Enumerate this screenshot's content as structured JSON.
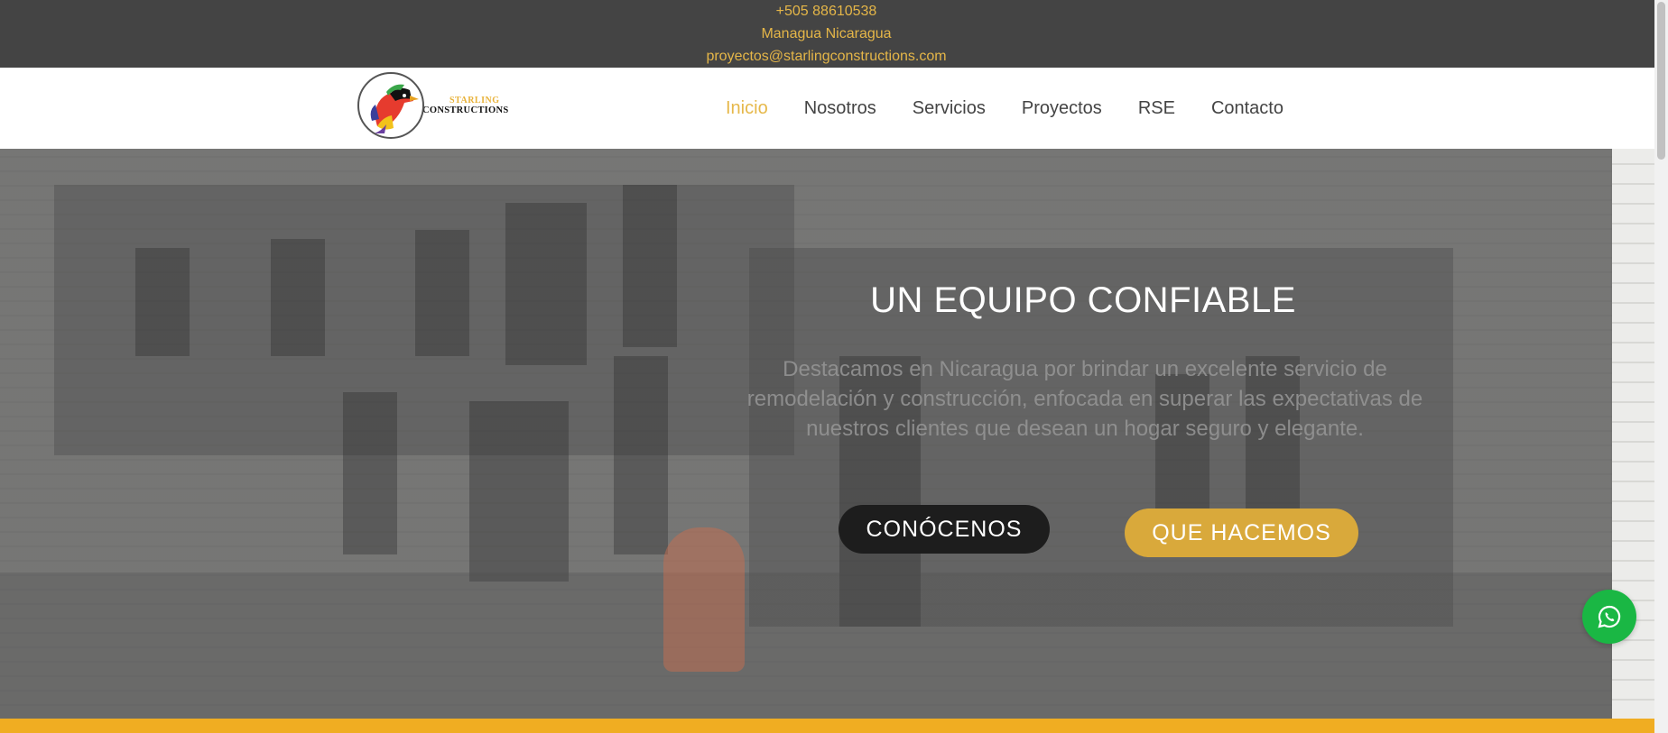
{
  "topbar": {
    "phone": "+505 88610538",
    "location": "Managua Nicaragua",
    "email": "proyectos@starlingconstructions.com"
  },
  "logo": {
    "line1": "STARLING",
    "line2": "CONSTRUCTIONS"
  },
  "nav": {
    "items": [
      {
        "label": "Inicio",
        "active": true
      },
      {
        "label": "Nosotros"
      },
      {
        "label": "Servicios"
      },
      {
        "label": "Proyectos"
      },
      {
        "label": "RSE"
      },
      {
        "label": "Contacto"
      }
    ]
  },
  "hero": {
    "title": "UN EQUIPO CONFIABLE",
    "text": "Destacamos en Nicaragua por brindar un excelente servicio de remodelación y construcción, enfocada en superar las expectativas de nuestros clientes que desean un hogar seguro y elegante.",
    "btn_primary": "CONÓCENOS",
    "btn_secondary": "QUE HACEMOS"
  },
  "colors": {
    "accent": "#e6b84a",
    "topbar": "#444444",
    "whatsapp": "#1ab744",
    "band": "#f0ad22"
  },
  "icons": {
    "whatsapp": "whatsapp-icon"
  }
}
